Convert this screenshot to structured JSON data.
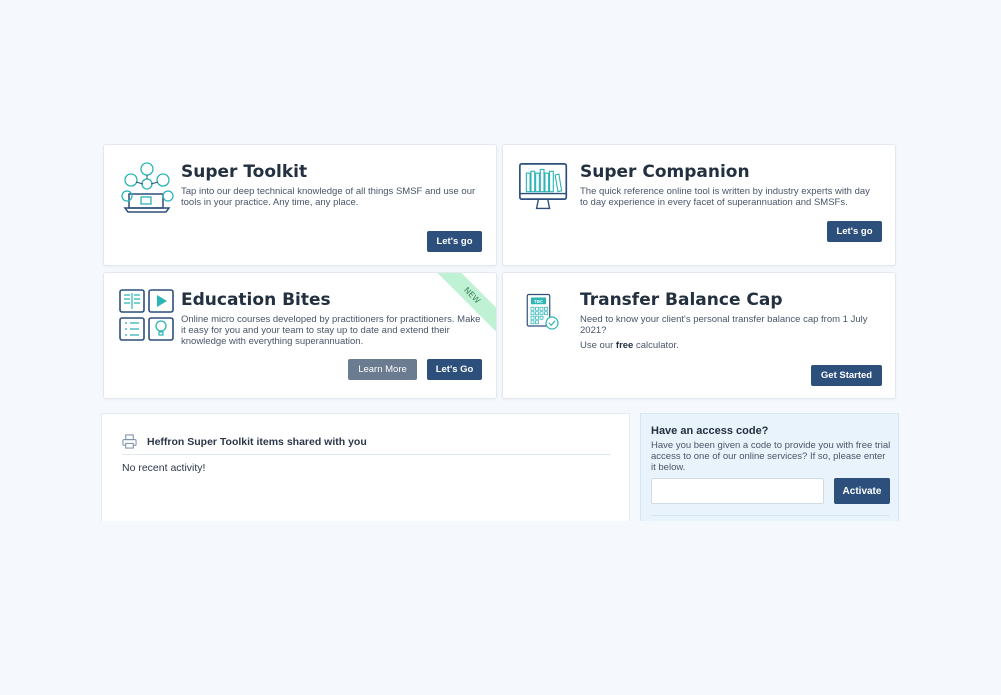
{
  "cards": {
    "toolkit": {
      "title": "Super Toolkit",
      "description": "Tap into our deep technical knowledge of all things SMSF and use our tools in your practice. Any time, any place.",
      "button": "Let's go",
      "icon": "toolkit-laptop-icon"
    },
    "companion": {
      "title": "Super Companion",
      "description": "The quick reference online tool is written by industry experts with day to day experience in every facet of superannuation and SMSFs.",
      "button": "Let's go",
      "icon": "monitor-books-icon"
    },
    "education": {
      "title": "Education Bites",
      "description": "Online micro courses developed by practitioners for practitioners. Make it easy for you and your team to stay up to date and extend their knowledge with everything superannuation.",
      "button_secondary": "Learn More",
      "button_primary": "Let's Go",
      "ribbon": "NEW",
      "icon": "education-grid-icon"
    },
    "transfer": {
      "title": "Transfer Balance Cap",
      "description": "Need to know your client's personal transfer balance cap from 1 July 2021?",
      "note_prefix": "Use our ",
      "note_bold": "free",
      "note_suffix": " calculator.",
      "button": "Get Started",
      "icon_label": "TBC",
      "icon": "calculator-icon"
    }
  },
  "shared": {
    "title": "Heffron Super Toolkit items shared with you",
    "empty": "No recent activity!",
    "icon": "printer-icon"
  },
  "access": {
    "title": "Have an access code?",
    "description": "Have you been given a code to provide you with free trial access to one of our online services? If so, please enter it below.",
    "input_value": "",
    "button": "Activate"
  },
  "colors": {
    "primary": "#2d4f7c",
    "accent_teal": "#2bb5b5",
    "ribbon": "#bff2d4",
    "background": "#f5f8fc"
  }
}
